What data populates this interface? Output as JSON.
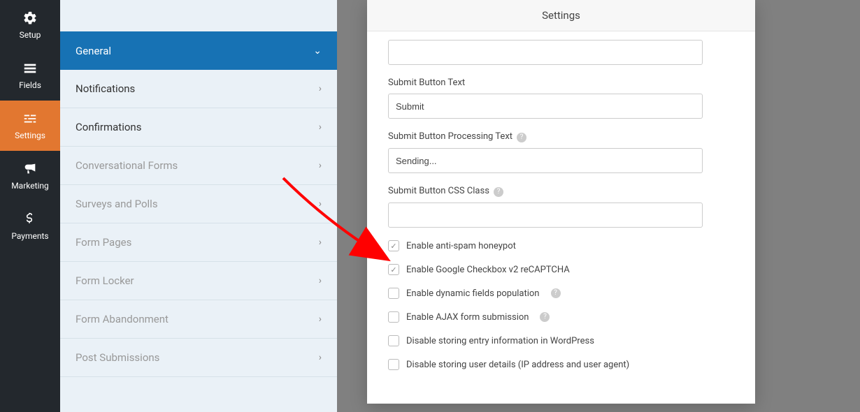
{
  "nav": {
    "setup": "Setup",
    "fields": "Fields",
    "settings": "Settings",
    "marketing": "Marketing",
    "payments": "Payments"
  },
  "panel": {
    "general": "General",
    "notifications": "Notifications",
    "confirmations": "Confirmations",
    "conversational": "Conversational Forms",
    "surveys": "Surveys and Polls",
    "formpages": "Form Pages",
    "formlocker": "Form Locker",
    "abandonment": "Form Abandonment",
    "postsubmissions": "Post Submissions"
  },
  "modal": {
    "title": "Settings",
    "submit_text_label": "Submit Button Text",
    "submit_text_value": "Submit",
    "processing_label": "Submit Button Processing Text",
    "processing_value": "Sending...",
    "css_label": "Submit Button CSS Class",
    "css_value": "",
    "cb_honeypot": "Enable anti-spam honeypot",
    "cb_recaptcha": "Enable Google Checkbox v2 reCAPTCHA",
    "cb_dynamic": "Enable dynamic fields population",
    "cb_ajax": "Enable AJAX form submission",
    "cb_disable_entry": "Disable storing entry information in WordPress",
    "cb_disable_user": "Disable storing user details (IP address and user agent)"
  }
}
